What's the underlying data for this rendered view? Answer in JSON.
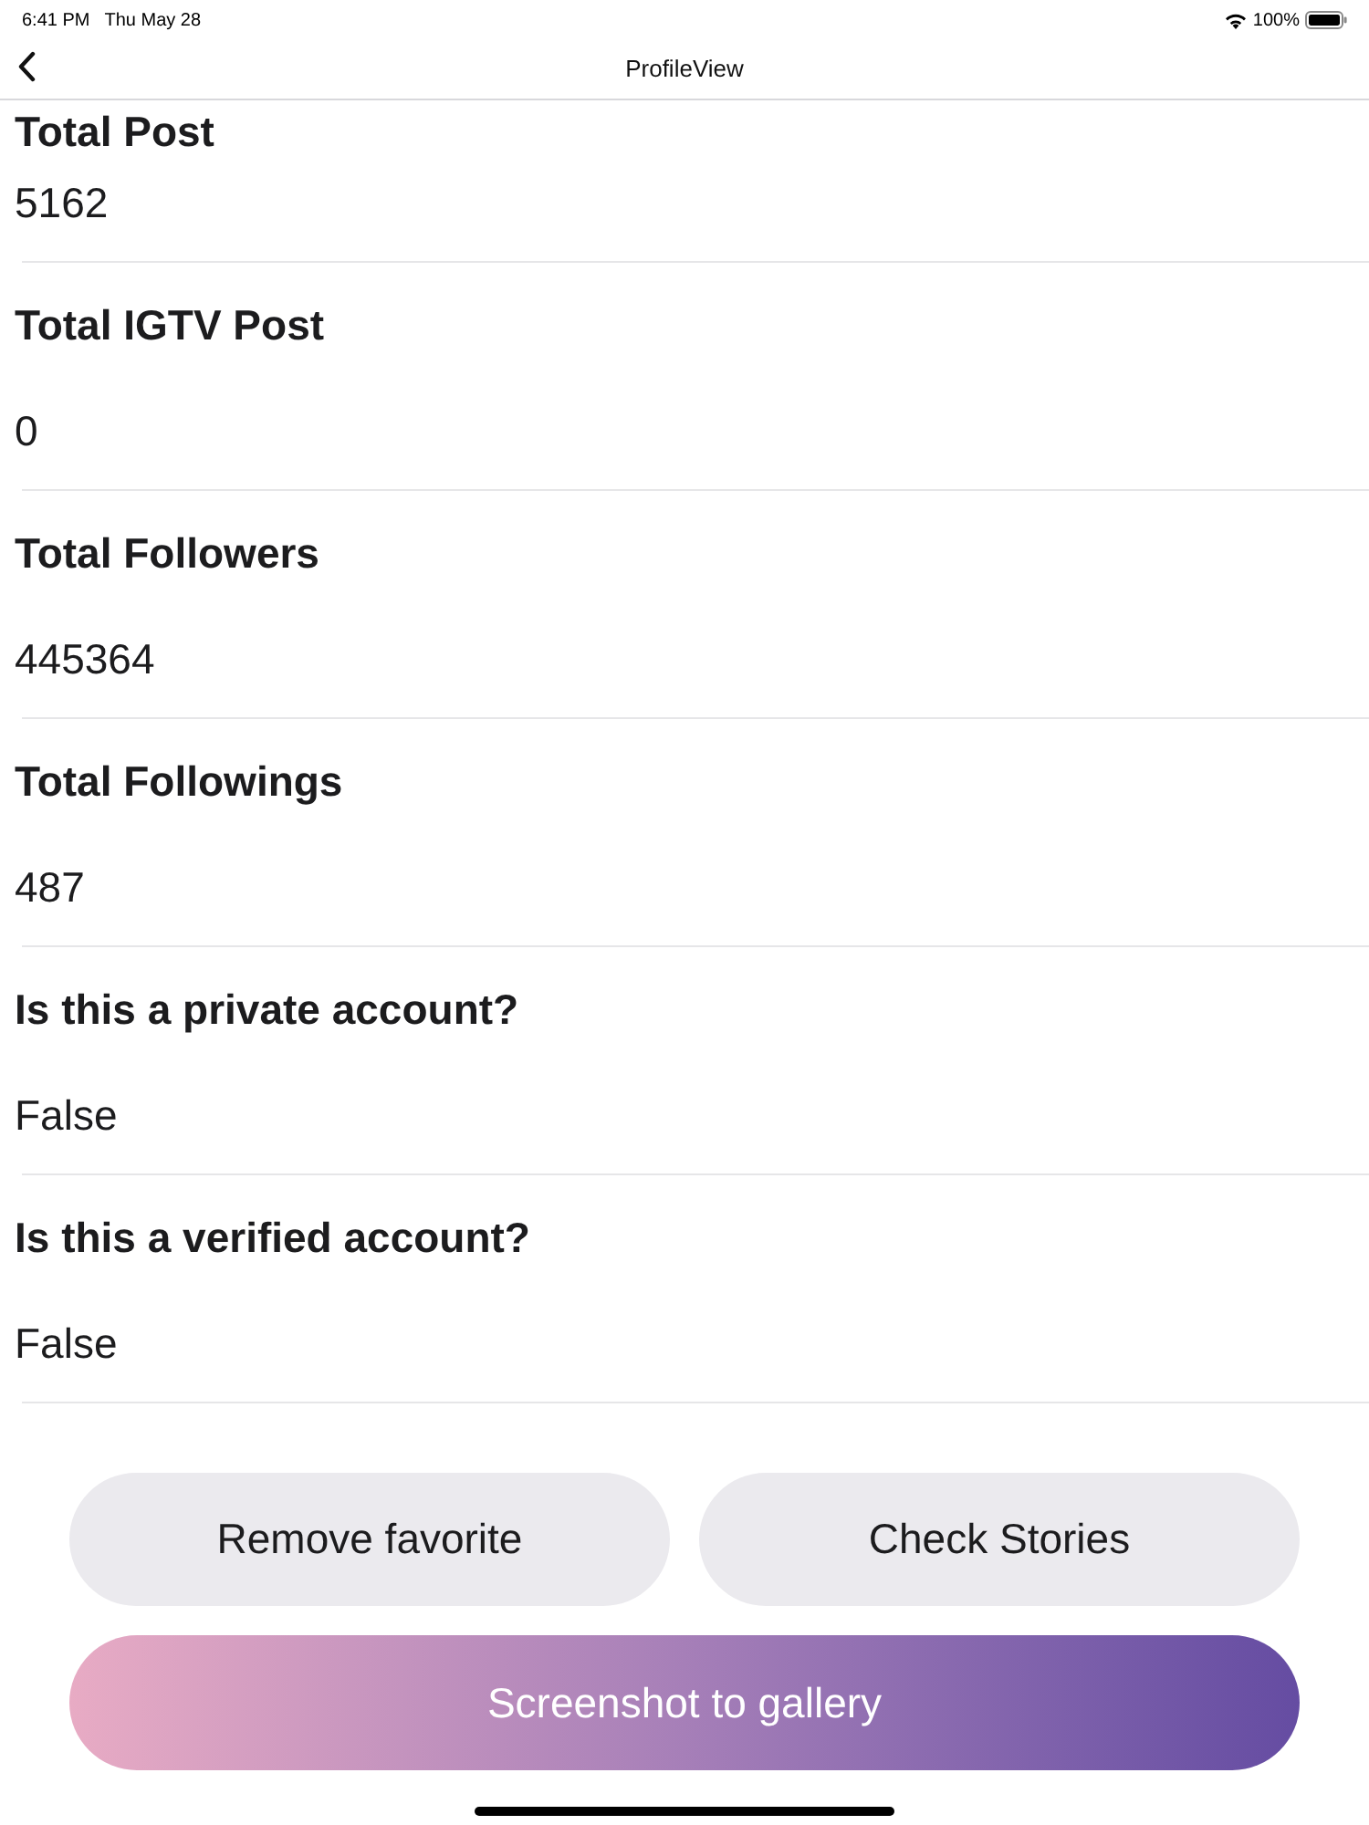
{
  "status_bar": {
    "time": "6:41 PM",
    "date": "Thu May 28",
    "battery_percent": "100%"
  },
  "nav_bar": {
    "title": "ProfileView"
  },
  "fields": [
    {
      "label": "Total Post",
      "value": "5162"
    },
    {
      "label": "Total IGTV Post",
      "value": "0"
    },
    {
      "label": "Total Followers",
      "value": "445364"
    },
    {
      "label": "Total Followings",
      "value": "487"
    },
    {
      "label": "Is this a private account?",
      "value": "False"
    },
    {
      "label": "Is this a verified account?",
      "value": "False"
    }
  ],
  "buttons": [
    {
      "label": "Remove favorite",
      "kind": "secondary"
    },
    {
      "label": "Check Stories",
      "kind": "secondary"
    },
    {
      "label": "Screenshot to gallery",
      "kind": "primary"
    }
  ]
}
